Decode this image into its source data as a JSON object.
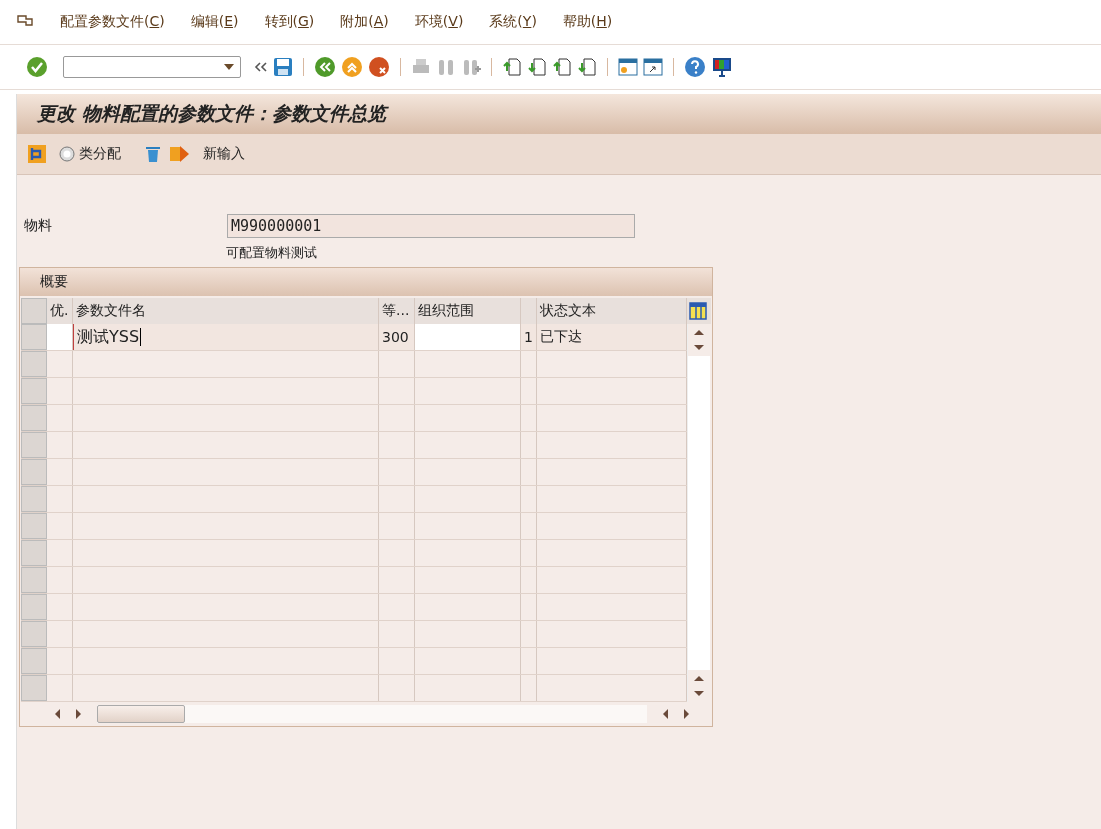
{
  "menu": [
    {
      "before": "配置参数文件(",
      "key": "C",
      "after": ")"
    },
    {
      "before": "编辑(",
      "key": "E",
      "after": ")"
    },
    {
      "before": "转到(",
      "key": "G",
      "after": ")"
    },
    {
      "before": "附加(",
      "key": "A",
      "after": ")"
    },
    {
      "before": "环境(",
      "key": "V",
      "after": ")"
    },
    {
      "before": "系统(",
      "key": "Y",
      "after": ")"
    },
    {
      "before": "帮助(",
      "key": "H",
      "after": ")"
    }
  ],
  "title": "更改 物料配置的参数文件：参数文件总览",
  "app_toolbar": {
    "class_assignment": "类分配",
    "new_entries": "新输入"
  },
  "material": {
    "label": "物料",
    "value": "M990000001",
    "description": "可配置物料测试"
  },
  "table": {
    "title": "概要",
    "columns": [
      "优.",
      "参数文件名",
      "等...",
      "组织范围",
      "",
      "状态文本"
    ],
    "rows": [
      {
        "cells": [
          "",
          "测试YSS",
          "300",
          "",
          "1",
          "已下达"
        ]
      }
    ]
  }
}
